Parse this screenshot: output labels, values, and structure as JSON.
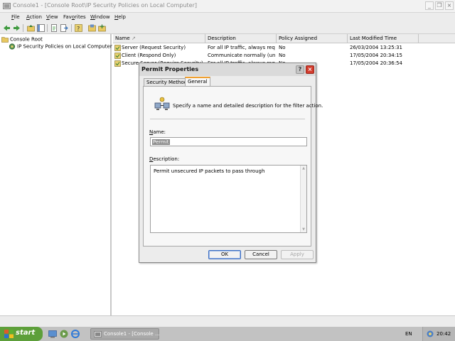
{
  "window": {
    "title": "Console1 - [Console Root\\IP Security Policies on Local Computer]",
    "caption_minimize": "_",
    "caption_restore": "❐",
    "caption_close": "×"
  },
  "menu": {
    "items": [
      {
        "key": "F",
        "rest": "ile"
      },
      {
        "key": "A",
        "rest": "ction"
      },
      {
        "key": "V",
        "rest": "iew"
      },
      {
        "key": "",
        "pre": "Fav",
        "key2": "o",
        "rest": "rites"
      },
      {
        "key": "W",
        "rest": "indow"
      },
      {
        "key": "H",
        "rest": "elp"
      }
    ]
  },
  "toolbar": {
    "buttons": [
      "back-icon",
      "forward-icon",
      "up-folder-icon",
      "show-tree-icon",
      "new-icon",
      "export-list-icon",
      "help-icon",
      "manage-filters-icon",
      "add-policy-icon"
    ]
  },
  "tree": {
    "root": "Console Root",
    "child": "IP Security Policies on Local Computer"
  },
  "list": {
    "columns": [
      "Name",
      "Description",
      "Policy Assigned",
      "Last Modified Time"
    ],
    "rows": [
      {
        "name": "Server (Request Security)",
        "description": "For all IP traffic, always req...",
        "assigned": "No",
        "modified": "26/03/2004 13:25:31"
      },
      {
        "name": "Client (Respond Only)",
        "description": "Communicate normally (uns...",
        "assigned": "No",
        "modified": "17/05/2004 20:34:15"
      },
      {
        "name": "Secure Server (Require Security)",
        "description": "For all IP traffic, always req...",
        "assigned": "No",
        "modified": "17/05/2004 20:36:54"
      }
    ]
  },
  "dialog": {
    "title": "Permit Properties",
    "help_glyph": "?",
    "close_glyph": "×",
    "tabs": [
      "Security Methods",
      "General"
    ],
    "active_tab": "General",
    "intro": "Specify a name and detailed description for the filter action.",
    "name_label_key": "N",
    "name_label_rest": "ame:",
    "name_value": "Permit",
    "desc_label_key": "D",
    "desc_label_rest": "escription:",
    "desc_value": "Permit unsecured IP packets to pass through",
    "ok": "OK",
    "cancel": "Cancel",
    "apply": "Apply"
  },
  "taskbar": {
    "start": "start",
    "task_label": "Console1 - [Console ...",
    "language": "EN",
    "clock": "20:42"
  },
  "colors": {
    "start_green": "#5d9f3a",
    "close_red": "#d33b2c",
    "active_tab_accent": "#f0a030",
    "selection_gray": "#8a8a8a"
  }
}
